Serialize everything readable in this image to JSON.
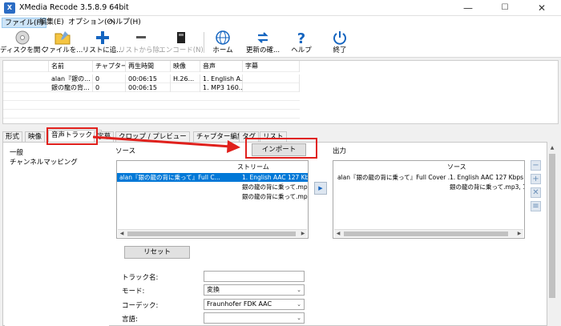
{
  "window": {
    "title": "XMedia Recode 3.5.8.9 64bit",
    "icon_text": "X"
  },
  "menu": [
    "ファイル(F)",
    "編集(E)",
    "オプション(O)",
    "ヘルプ(H)"
  ],
  "toolbar": [
    {
      "label": "ディスクを開く",
      "icon": "disc-icon",
      "enabled": true
    },
    {
      "label": "ファイルを...",
      "icon": "folder-icon",
      "enabled": true
    },
    {
      "label": "リストに追...",
      "icon": "plus-icon",
      "enabled": true
    },
    {
      "label": "リストから除...",
      "icon": "minus-icon",
      "enabled": false
    },
    {
      "label": "エンコード(N)",
      "icon": "encode-icon",
      "enabled": false
    },
    {
      "label": "ホーム",
      "icon": "globe-icon",
      "enabled": true
    },
    {
      "label": "更新の確...",
      "icon": "refresh-icon",
      "enabled": true
    },
    {
      "label": "ヘルプ",
      "icon": "question-icon",
      "enabled": true
    },
    {
      "label": "終了",
      "icon": "power-icon",
      "enabled": true
    }
  ],
  "file_list": {
    "columns": [
      "名前",
      "チャプター",
      "再生時間",
      "映像",
      "音声",
      "字幕"
    ],
    "rows": [
      [
        "alan『銀の...",
        "0",
        "00:06:15",
        "H.26...",
        "1. English A...",
        ""
      ],
      [
        "銀の龍の背...",
        "0",
        "00:06:15",
        "",
        "1. MP3 160...",
        ""
      ]
    ]
  },
  "tabs": [
    "形式",
    "映像",
    "音声トラック 1",
    "字幕",
    "クロップ / プレビュー",
    "チャプター編集",
    "タグ",
    "リスト"
  ],
  "left_nav": [
    "一般",
    "チャンネルマッピング"
  ],
  "source": {
    "label": "ソース",
    "column": "ストリーム",
    "rows": [
      {
        "name": "alan『銀の龍の背に乗って』Full C...",
        "stream": "1. English AAC  127 Kbps 44100"
      },
      {
        "name": "",
        "stream": "銀の龍の背に乗って.mp3, 1. MP."
      },
      {
        "name": "",
        "stream": "銀の龍の背に乗って.mp3, 1. MP."
      }
    ]
  },
  "import_button": "インポート",
  "output": {
    "label": "出力",
    "column": "ソース",
    "rows": [
      {
        "name": "alan『銀の龍の背に乗って』Full Cover ...",
        "stream": "1. English AAC  127 Kbps 44"
      },
      {
        "name": "",
        "stream": "銀の龍の背に乗って.mp3, 1. MP."
      }
    ]
  },
  "reset_button": "リセット",
  "form": {
    "track_name_label": "トラック名:",
    "track_name_value": "",
    "mode_label": "モード:",
    "mode_value": "変換",
    "codec_label": "コーデック:",
    "codec_value": "Fraunhofer FDK AAC",
    "language_label": "言語:",
    "language_value": ""
  },
  "colors": {
    "accent": "#e0201c",
    "selection": "#0078d7"
  }
}
